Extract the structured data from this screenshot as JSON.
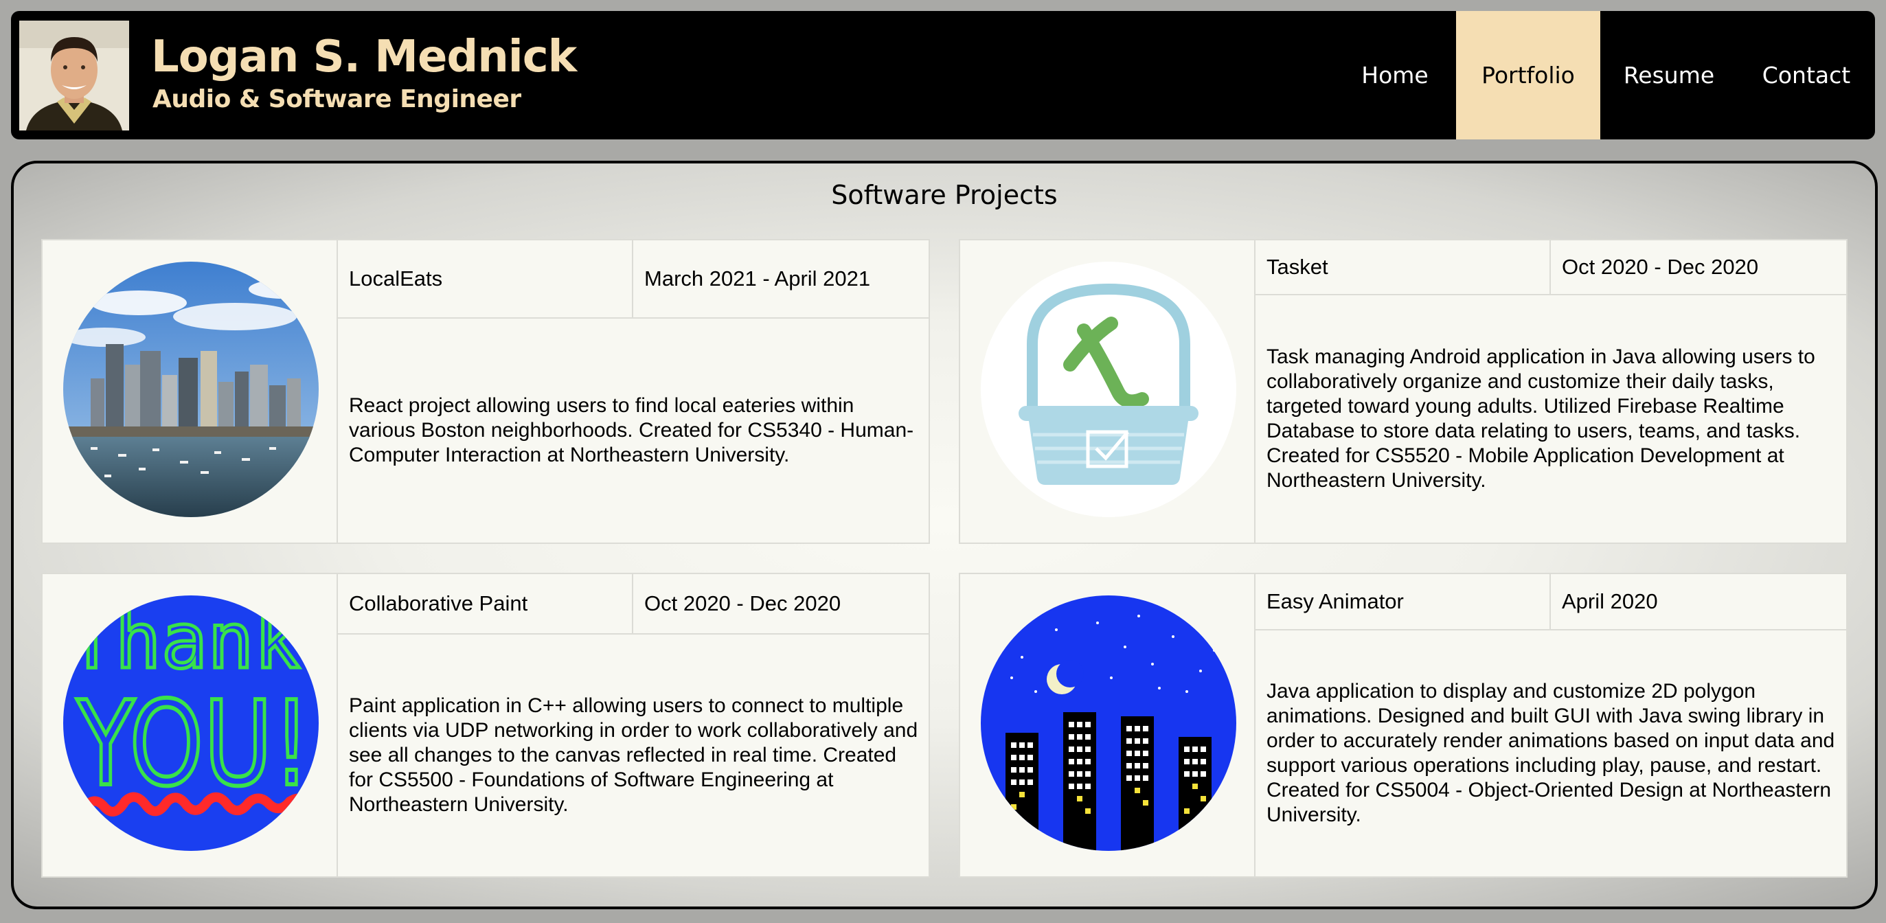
{
  "header": {
    "name": "Logan S. Mednick",
    "subtitle": "Audio & Software Engineer",
    "nav": [
      {
        "label": "Home"
      },
      {
        "label": "Portfolio",
        "active": true
      },
      {
        "label": "Resume"
      },
      {
        "label": "Contact"
      }
    ]
  },
  "colors": {
    "accent": "#f5deb3",
    "header_bg": "#000000"
  },
  "main": {
    "title": "Software Projects",
    "projects": [
      {
        "name": "LocalEats",
        "date": "March 2021 - April 2021",
        "description": "React project allowing users to find local eateries within various Boston neighborhoods. Created for CS5340 - Human-Computer Interaction at Northeastern University.",
        "image": "boston-skyline-image"
      },
      {
        "name": "Tasket",
        "date": "Oct 2020 - Dec 2020",
        "description": "Task managing Android application in Java allowing users to collaboratively organize and customize their daily tasks, targeted toward young adults. Utilized Firebase Realtime Database to store data relating to users, teams, and tasks. Created for CS5520 - Mobile Application Development at Northeastern University.",
        "image": "tasket-basket-logo"
      },
      {
        "name": "Collaborative Paint",
        "date": "Oct 2020 - Dec 2020",
        "description": "Paint application in C++ allowing users to connect to multiple clients via UDP networking in order to work collaboratively and see all changes to the canvas reflected in real time. Created for CS5500 - Foundations of Software Engineering at Northeastern University.",
        "image": "thank-you-paint-image",
        "image_text": [
          "Thank",
          "YOU!"
        ]
      },
      {
        "name": "Easy Animator",
        "date": "April 2020",
        "description": "Java application to display and customize 2D polygon animations. Designed and built GUI with Java swing library in order to accurately render animations based on input data and support various operations including play, pause, and restart. Created for CS5004 - Object-Oriented Design at Northeastern University.",
        "image": "night-city-animation-image"
      }
    ]
  }
}
